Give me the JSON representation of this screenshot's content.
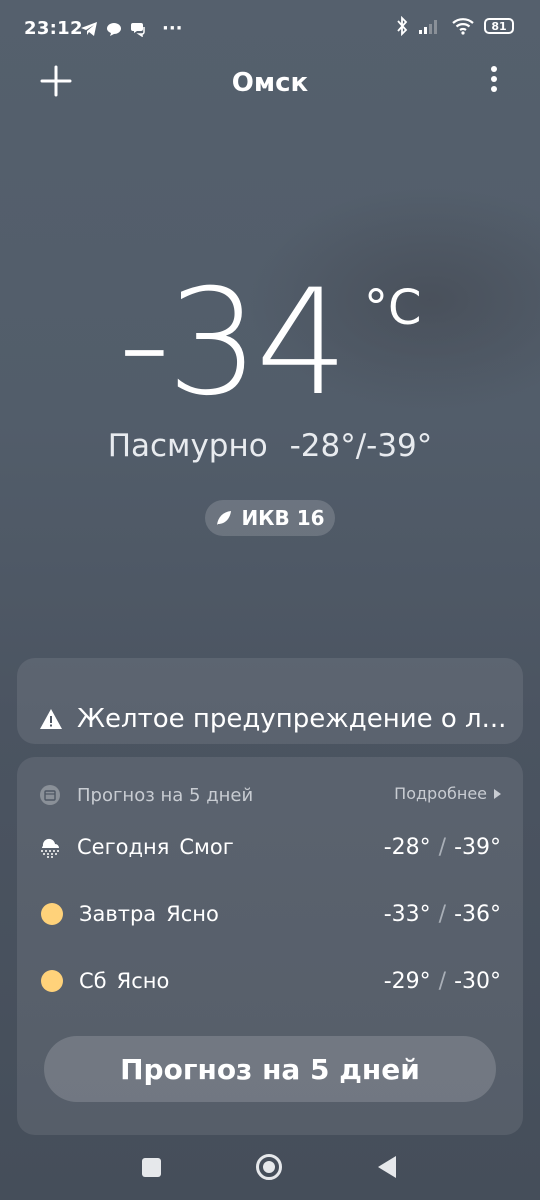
{
  "status_bar": {
    "time": "23:12",
    "more": "···",
    "battery": "81"
  },
  "header": {
    "city": "Омск"
  },
  "current": {
    "temperature": "-34",
    "unit": "°C",
    "condition": "Пасмурно",
    "high_low": "-28°/-39°",
    "aqi_label": "ИКВ 16"
  },
  "warning": {
    "text": "Желтое предупреждение о л..."
  },
  "forecast": {
    "title": "Прогноз на 5 дней",
    "more_label": "Подробнее",
    "rows": [
      {
        "day": "Сегодня",
        "condition": "Смог",
        "high": "-28°",
        "low": "-39°",
        "icon": "fog-icon"
      },
      {
        "day": "Завтра",
        "condition": "Ясно",
        "high": "-33°",
        "low": "-36°",
        "icon": "sun-icon"
      },
      {
        "day": "Сб",
        "condition": "Ясно",
        "high": "-29°",
        "low": "-30°",
        "icon": "sun-icon"
      }
    ],
    "button_label": "Прогноз на 5 дней"
  },
  "colors": {
    "background": "#525d6a",
    "sun": "#ffd27a"
  }
}
